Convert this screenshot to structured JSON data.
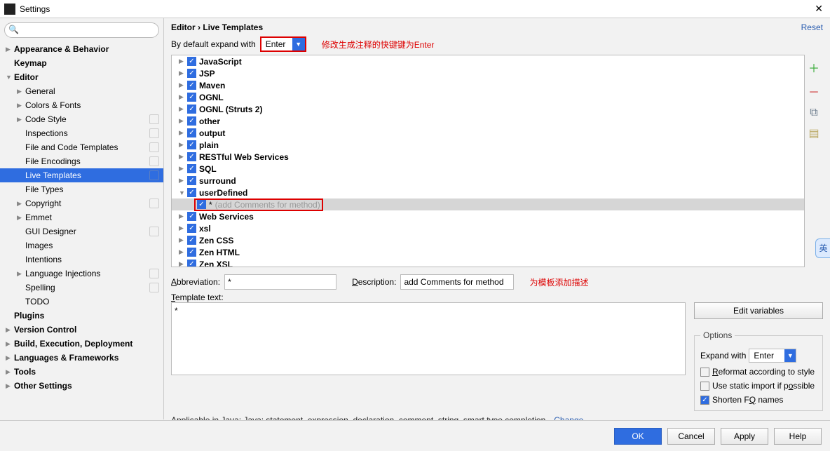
{
  "window": {
    "title": "Settings",
    "close": "✕"
  },
  "sidebar": {
    "search_placeholder": "",
    "items": [
      {
        "label": "Appearance & Behavior",
        "bold": true,
        "exp": "▶",
        "ind": 0
      },
      {
        "label": "Keymap",
        "bold": true,
        "ind": 0
      },
      {
        "label": "Editor",
        "bold": true,
        "exp": "▼",
        "ind": 0
      },
      {
        "label": "General",
        "exp": "▶",
        "ind": 1
      },
      {
        "label": "Colors & Fonts",
        "exp": "▶",
        "ind": 1
      },
      {
        "label": "Code Style",
        "exp": "▶",
        "ind": 1,
        "badge": true
      },
      {
        "label": "Inspections",
        "ind": 1,
        "badge": true
      },
      {
        "label": "File and Code Templates",
        "ind": 1,
        "badge": true
      },
      {
        "label": "File Encodings",
        "ind": 1,
        "badge": true
      },
      {
        "label": "Live Templates",
        "ind": 1,
        "badge": true,
        "selected": true
      },
      {
        "label": "File Types",
        "ind": 1
      },
      {
        "label": "Copyright",
        "exp": "▶",
        "ind": 1,
        "badge": true
      },
      {
        "label": "Emmet",
        "exp": "▶",
        "ind": 1
      },
      {
        "label": "GUI Designer",
        "ind": 1,
        "badge": true
      },
      {
        "label": "Images",
        "ind": 1
      },
      {
        "label": "Intentions",
        "ind": 1
      },
      {
        "label": "Language Injections",
        "exp": "▶",
        "ind": 1,
        "badge": true
      },
      {
        "label": "Spelling",
        "ind": 1,
        "badge": true
      },
      {
        "label": "TODO",
        "ind": 1
      },
      {
        "label": "Plugins",
        "bold": true,
        "ind": 0
      },
      {
        "label": "Version Control",
        "bold": true,
        "exp": "▶",
        "ind": 0
      },
      {
        "label": "Build, Execution, Deployment",
        "bold": true,
        "exp": "▶",
        "ind": 0
      },
      {
        "label": "Languages & Frameworks",
        "bold": true,
        "exp": "▶",
        "ind": 0
      },
      {
        "label": "Tools",
        "bold": true,
        "exp": "▶",
        "ind": 0
      },
      {
        "label": "Other Settings",
        "bold": true,
        "exp": "▶",
        "ind": 0
      }
    ]
  },
  "main": {
    "breadcrumb": "Editor › Live Templates",
    "reset": "Reset",
    "default_expand_label": "By default expand with",
    "default_expand_value": "Enter",
    "anno1": "修改生成注释的快键键为Enter",
    "tree": [
      {
        "label": "JavaScript",
        "bold": true
      },
      {
        "label": "JSP",
        "bold": true
      },
      {
        "label": "Maven",
        "bold": true
      },
      {
        "label": "OGNL",
        "bold": true
      },
      {
        "label": "OGNL (Struts 2)",
        "bold": true
      },
      {
        "label": "other",
        "bold": true
      },
      {
        "label": "output",
        "bold": true
      },
      {
        "label": "plain",
        "bold": true
      },
      {
        "label": "RESTful Web Services",
        "bold": true
      },
      {
        "label": "SQL",
        "bold": true
      },
      {
        "label": "surround",
        "bold": true
      },
      {
        "label": "userDefined",
        "bold": true,
        "exp": "▼"
      },
      {
        "label": "*",
        "muted": "(add Comments for method)",
        "sub": true,
        "sel": true
      },
      {
        "label": "Web Services",
        "bold": true
      },
      {
        "label": "xsl",
        "bold": true
      },
      {
        "label": "Zen CSS",
        "bold": true
      },
      {
        "label": "Zen HTML",
        "bold": true
      },
      {
        "label": "Zen XSL",
        "bold": true
      }
    ],
    "abbr_label": "Abbreviation:",
    "abbr_value": "*",
    "desc_label": "Description:",
    "desc_value": "add Comments for method",
    "anno2": "为模板添加描述",
    "template_label": "Template text:",
    "template_value": "*",
    "edit_vars": "Edit variables",
    "options_title": "Options",
    "expand_with_label": "Expand with",
    "expand_with_value": "Enter",
    "reformat_label": "Reformat according to style",
    "static_import_label": "Use static import if possible",
    "shorten_fq_label": "Shorten FQ names",
    "applicable_text": "Applicable in Java; Java: statement, expression, declaration, comment, string, smart type completion…",
    "change": "Change"
  },
  "footer": {
    "ok": "OK",
    "cancel": "Cancel",
    "apply": "Apply",
    "help": "Help"
  },
  "ime": "英"
}
